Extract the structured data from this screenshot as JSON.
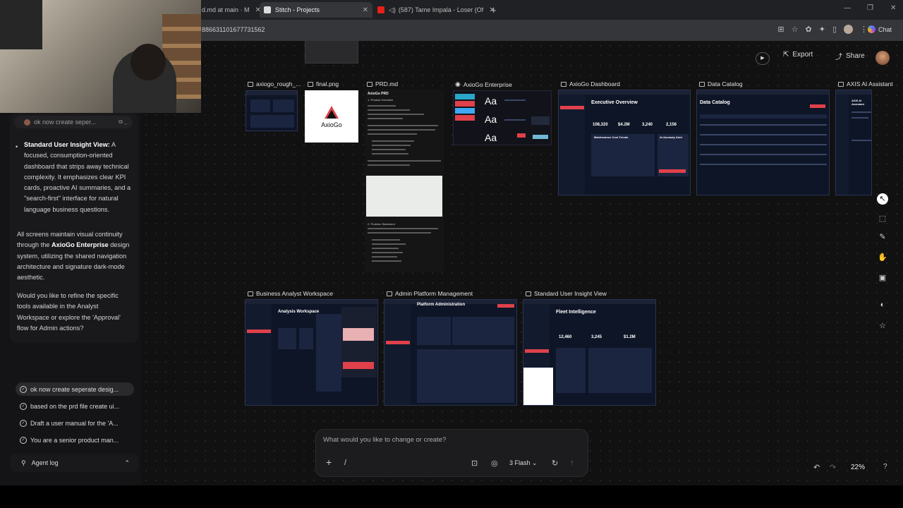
{
  "browser": {
    "tabs": [
      {
        "label": "d.md at main · M"
      },
      {
        "label": "Stitch - Projects"
      },
      {
        "label": "(587) Tame Impala - Loser (Of"
      }
    ],
    "address": "886631101677731562",
    "chat_label": "Chat",
    "new_tab": "+"
  },
  "chat": {
    "prompt_chip": "ok now create seper...",
    "bullet_title": "Standard User Insight View:",
    "bullet_body": "A focused, consumption-oriented dashboard that strips away technical complexity. It emphasizes clear KPI cards, proactive AI summaries, and a \"search-first\" interface for natural language business questions.",
    "para1_a": "All screens maintain visual continuity through the ",
    "para1_b": "AxioGo Enterprise",
    "para1_c": " design system, utilizing the shared navigation architecture and signature dark-mode aesthetic.",
    "para2": "Would you like to refine the specific tools available in the Analyst Workspace or explore the 'Approval' flow for Admin actions?"
  },
  "history": [
    {
      "label": "ok now create seperate desig..."
    },
    {
      "label": "based on the prd file create ui..."
    },
    {
      "label": "Draft a user manual for the 'A..."
    },
    {
      "label": "You are a senior product man..."
    }
  ],
  "agent_log": "Agent log",
  "toolbar": {
    "export": "Export",
    "share": "Share"
  },
  "cards": {
    "axiogo_rough": "axiogo_rough_...",
    "final_png": "final.png",
    "prd_md": "PRD.md",
    "enterprise": "AxioGo Enterprise",
    "dashboard": "AxioGo Dashboard",
    "catalog": "Data Catalog",
    "assistant": "AXIS AI Assistant",
    "analyst": "Business Analyst Workspace",
    "admin": "Admin Platform Management",
    "insight": "Standard User Insight View"
  },
  "thumbs": {
    "logo": "AxioGo",
    "prd_title": "AxioGo PRD",
    "prd_h1": "1. Product Overview",
    "prd_h2": "2. Problem Statement",
    "aa": "Aa",
    "dash_title": "Executive Overview",
    "dash_k1": "108,320",
    "dash_k2": "$4.2M",
    "dash_k3": "3,240",
    "dash_k4": "2,156",
    "dash_trend": "Maintenance Cost Trends",
    "dash_alert": "AI Anomaly Alert",
    "catalog_title": "Data Catalog",
    "assist_title": "AXIS AI Assistant",
    "analyst_title": "Analysis Workspace",
    "admin_title": "Platform Administration",
    "insight_title": "Fleet Intelligence",
    "insight_k1": "12,460",
    "insight_k2": "3,245",
    "insight_k3": "$1.2M"
  },
  "composer": {
    "placeholder": "What would you like to change or create?",
    "model": "3 Flash",
    "zoom": "22%"
  }
}
